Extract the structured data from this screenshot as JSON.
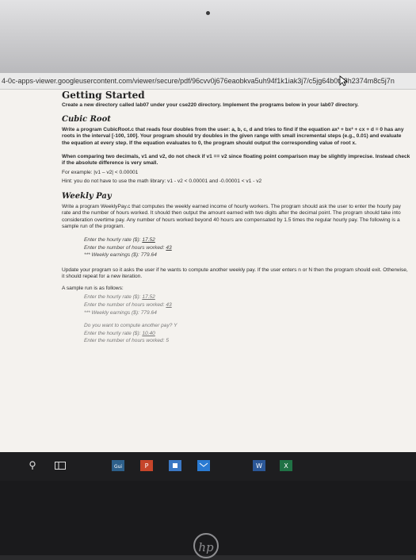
{
  "browser": {
    "url": "4-0c-apps-viewer.googleusercontent.com/viewer/secure/pdf/96cvv0j676eaobkva5uh94f1k1iak3j7/c5jg64b0t48h2374m8c5j7n"
  },
  "document": {
    "title": "Getting Started",
    "intro": "Create a new directory called lab07 under your cse220 directory. Implement the programs below in your lab07 directory.",
    "cubic": {
      "heading": "Cubic Root",
      "para1": "Write a program CubicRoot.c that reads four doubles from the user: a, b, c, d and tries to find if the equation ax³ + bx² + cx + d = 0 has any roots in the interval [-100, 100]. Your program should try doubles in the given range with small incremental steps (e.g., 0.01) and evaluate the equation at every step. If the equation evaluates to 0, the program should output the corresponding value of root x.",
      "para2": "When comparing two decimals, v1 and v2, do not check if v1 == v2 since floating point comparison may be slightly imprecise. Instead check if the absolute difference is very small.",
      "example": "For example: |v1 – v2| < 0.00001",
      "hint": "Hint: you do not have to use the math library: v1 - v2 < 0.00001 and -0.00001 < v1 - v2"
    },
    "weekly": {
      "heading": "Weekly Pay",
      "para1": "Write a program WeeklyPay.c that computes the weekly earned income of hourly workers. The program should ask the user to enter the hourly pay rate and the number of hours worked. It should then output the amount earned with two digits after the decimal point. The program should take into consideration overtime pay. Any number of hours worked beyond 40 hours are compensated by 1.5 times the regular hourly pay. The following is a sample run of the program.",
      "sample1": {
        "line1_label": "Enter the hourly rate ($):",
        "line1_value": "17.52",
        "line2_label": "Enter the number of hours worked:",
        "line2_value": "43",
        "line3": "*** Weekly earnings ($): 779.64"
      },
      "para2": "Update your program so it asks the user if he wants to compute another weekly pay. If the user enters n or N then the program should exit. Otherwise, it should repeat for a new iteration.",
      "sample_intro": "A sample run is as follows:",
      "sample2": {
        "line1_label": "Enter the hourly rate ($):",
        "line1_value": "17.52",
        "line2_label": "Enter the number of hours worked:",
        "line2_value": "43",
        "line3": "*** Weekly earnings ($): 779.64",
        "line4": "Do you want to compute another pay? Y",
        "line5_label": "Enter the hourly rate ($):",
        "line5_value": "10.40",
        "line6": "Enter the number of hours worked: 5"
      }
    }
  },
  "taskbar": {
    "colors": {
      "start": "#2b2b2b",
      "bing": "#2d5f8a",
      "ppt": "#c6452a",
      "store": "#3b78c4",
      "mail": "#2a7ad2",
      "word": "#2b5797",
      "excel": "#207245"
    }
  },
  "brand": {
    "logo_text": "hp"
  }
}
